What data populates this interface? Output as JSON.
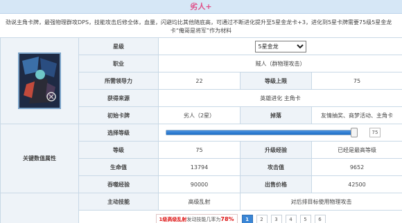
{
  "title": "劣人+",
  "description": {
    "line1": "劲说主角卡牌，最强物理群攻DPS，技能攻击后修全体，血量，闪避均比其他随底高，可通过不断进化提升至5星金龙卡+3，进化到5星卡牌需要75级5星金龙",
    "line2": "卡“俺哥是将军”作为材料"
  },
  "side": {
    "attr_label": "关键数值属性"
  },
  "info": {
    "star_label": "星级",
    "star_value": "5星金龙",
    "job_label": "职业",
    "job_value": "贼人（群物理攻击）",
    "leadership_label": "所需领导力",
    "leadership_value": "22",
    "level_cap_label": "等级上限",
    "level_cap_value": "75",
    "source_label": "获得来源",
    "source_value": "英雄进化  主角卡",
    "initial_label": "初始卡牌",
    "initial_value": "劣人（2星）",
    "drop_label": "掉落",
    "drop_value": "友情抽奖、商梦活动、主角卡"
  },
  "level_select": {
    "label": "选择等级",
    "value": "75",
    "progress_fraction": 1.0
  },
  "stats": {
    "level_label": "等级",
    "level_value": "75",
    "exp_label": "升级经验",
    "exp_value": "已经是最高等级",
    "hp_label": "生命值",
    "hp_value": "13794",
    "atk_label": "攻击值",
    "atk_value": "9652",
    "devour_label": "吞噬经验",
    "devour_value": "90000",
    "sell_label": "出售价格",
    "sell_value": "42500"
  },
  "skills": {
    "active_label": "主动技能",
    "active_name": "高级乱射",
    "active_desc": "对后排目标使用物理攻击",
    "detail_prefix": "1级",
    "detail_name": "高级乱射",
    "detail_mid": "发动技能几率为",
    "detail_pct": "78%",
    "pages": [
      "1",
      "2",
      "3",
      "4",
      "5",
      "6"
    ],
    "active_page": "1"
  },
  "colors": {
    "title": "#e0508a",
    "header_bg": "#eef3f8",
    "accent_blue": "#3a86d6"
  }
}
